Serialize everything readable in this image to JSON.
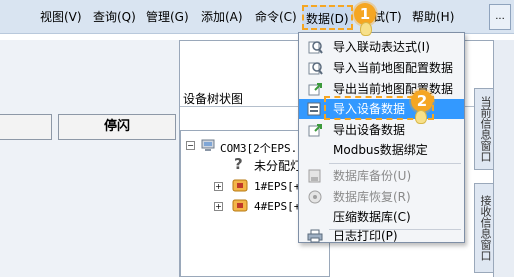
{
  "menubar": {
    "items": [
      {
        "label": "视图(V)"
      },
      {
        "label": "查询(Q)"
      },
      {
        "label": "管理(G)"
      },
      {
        "label": "添加(A)"
      },
      {
        "label": "命令(C)"
      },
      {
        "label": "数据(D)"
      },
      {
        "label": "调试(T)"
      },
      {
        "label": "帮助(H)"
      }
    ],
    "overflow": "..."
  },
  "left_panel": {
    "stop_button": "停闪"
  },
  "tree": {
    "title": "设备树状图",
    "nodes": [
      {
        "label": "COM3[2个EPS..."
      },
      {
        "label": "未分配灯"
      },
      {
        "label": "1#EPS[+]"
      },
      {
        "label": "4#EPS[+]"
      }
    ]
  },
  "right_tabs": [
    {
      "label": "当前信息窗口"
    },
    {
      "label": "接收信息窗口"
    }
  ],
  "data_menu": {
    "items": [
      {
        "label": "导入联动表达式(I)",
        "icon": "import-icon"
      },
      {
        "label": "导入当前地图配置数据",
        "icon": "import-map-icon"
      },
      {
        "label": "导出当前地图配置数据",
        "icon": "export-map-icon"
      },
      {
        "label": "导入设备数据",
        "icon": "import-device-icon"
      },
      {
        "label": "导出设备数据",
        "icon": "export-device-icon"
      },
      {
        "label": "Modbus数据绑定",
        "icon": ""
      },
      {
        "label": "数据库备份(U)",
        "icon": "backup-icon"
      },
      {
        "label": "数据库恢复(R)",
        "icon": "restore-icon"
      },
      {
        "label": "压缩数据库(C)",
        "icon": ""
      },
      {
        "label": "日志打印(P)",
        "icon": "print-icon"
      }
    ]
  },
  "annotations": {
    "step1": "1",
    "step2": "2"
  },
  "colors": {
    "menubar": "#d9e4f1",
    "highlight": "#3399ff",
    "annotation": "#f5a623"
  }
}
